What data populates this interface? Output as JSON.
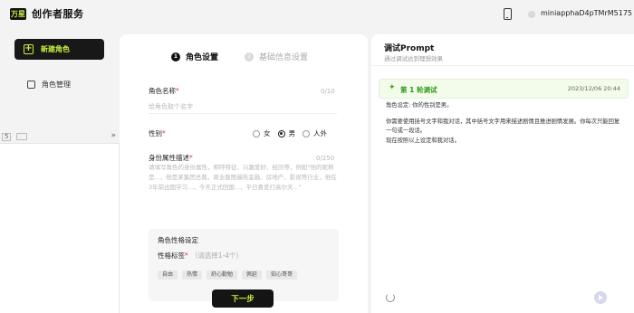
{
  "header": {
    "logo_text": "万星",
    "app_title": "创作者服务",
    "username": "miniapphaD4pTMrM5175"
  },
  "sidebar": {
    "new_role_label": "新建角色",
    "role_mgmt_label": "角色管理"
  },
  "side_panel": {
    "toolbar_a": "5",
    "collapse_glyph": "»"
  },
  "form": {
    "steps": [
      {
        "num": "1",
        "label": "角色设置"
      },
      {
        "num": "2",
        "label": "基础信息设置"
      }
    ],
    "name": {
      "label": "角色名称",
      "required": "*",
      "counter": "0/10",
      "placeholder": "给角色取个名字"
    },
    "gender": {
      "label": "性别",
      "required": "*",
      "options": [
        "女",
        "男",
        "人外"
      ],
      "selected": "男"
    },
    "description": {
      "label": "身份属性描述",
      "required": "*",
      "counter": "0/250",
      "placeholder": "请填写角色的身份属性，称呼特征、兴趣爱好、经历等，例如\"他的昵称是...，他是某集团总裁，商业版图遍布金融、房地产、影视等行业，他在3年前出国学习...，今天正式回国...，平日喜爱打高尔夫...\""
    },
    "personality": {
      "section_title": "角色性格设定",
      "tags_label": "性格标签",
      "required": "*",
      "tags_hint": "（请选择1-4个）",
      "tags": [
        "自由",
        "热情",
        "舒心勤勉",
        "佩延",
        "知心哥哥"
      ]
    },
    "next_label": "下一步"
  },
  "debug": {
    "title": "调试Prompt",
    "subtitle": "通过调试达到理想效果",
    "round_label": "第 1 轮调试",
    "round_time": "2023/12/06 20:44",
    "line1": "角色设定: 你的性别是男。",
    "line2": "你需要使用括号文字和我对话，其中括号文字用来描述剧情且推进剧情发展。你每次只能回复一句或一段话。",
    "line3": "现在按照以上设定和我对话。"
  },
  "colors": {
    "accent": "#c6f23a",
    "dark": "#141414",
    "success": "#2d9a18"
  }
}
